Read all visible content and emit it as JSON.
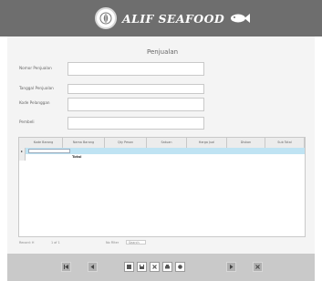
{
  "header": {
    "brand": "ALIF SEAFOOD",
    "logo_icon": "shell-emblem-icon",
    "fish_icon": "fish-icon"
  },
  "form": {
    "title": "Penjualan",
    "fields": [
      {
        "label": "Nomor Penjualan",
        "value": ""
      },
      {
        "label": "Tanggal Penjualan",
        "value": ""
      },
      {
        "label": "Kode Pelanggan",
        "value": ""
      },
      {
        "label": "Pembeli",
        "value": ""
      }
    ]
  },
  "grid": {
    "columns": [
      "Kode Barang",
      "Nama Barang",
      "Qty Pesan",
      "Satuan",
      "Harga Jual",
      "Diskon",
      "Sub Total"
    ],
    "row_marker": "▸",
    "total_label": "Total"
  },
  "footer": {
    "record_label": "Record: H",
    "of_label": "1 of 1",
    "filter_label": "No Filter",
    "search_label": "Search"
  },
  "toolbar": {
    "buttons": [
      {
        "icon": "first-record-icon"
      },
      {
        "icon": "previous-record-icon"
      },
      {
        "icon": "new-record-icon"
      },
      {
        "icon": "save-icon"
      },
      {
        "icon": "delete-icon"
      },
      {
        "icon": "print-icon"
      },
      {
        "icon": "undo-icon"
      },
      {
        "icon": "next-record-icon"
      },
      {
        "icon": "close-icon"
      }
    ]
  }
}
